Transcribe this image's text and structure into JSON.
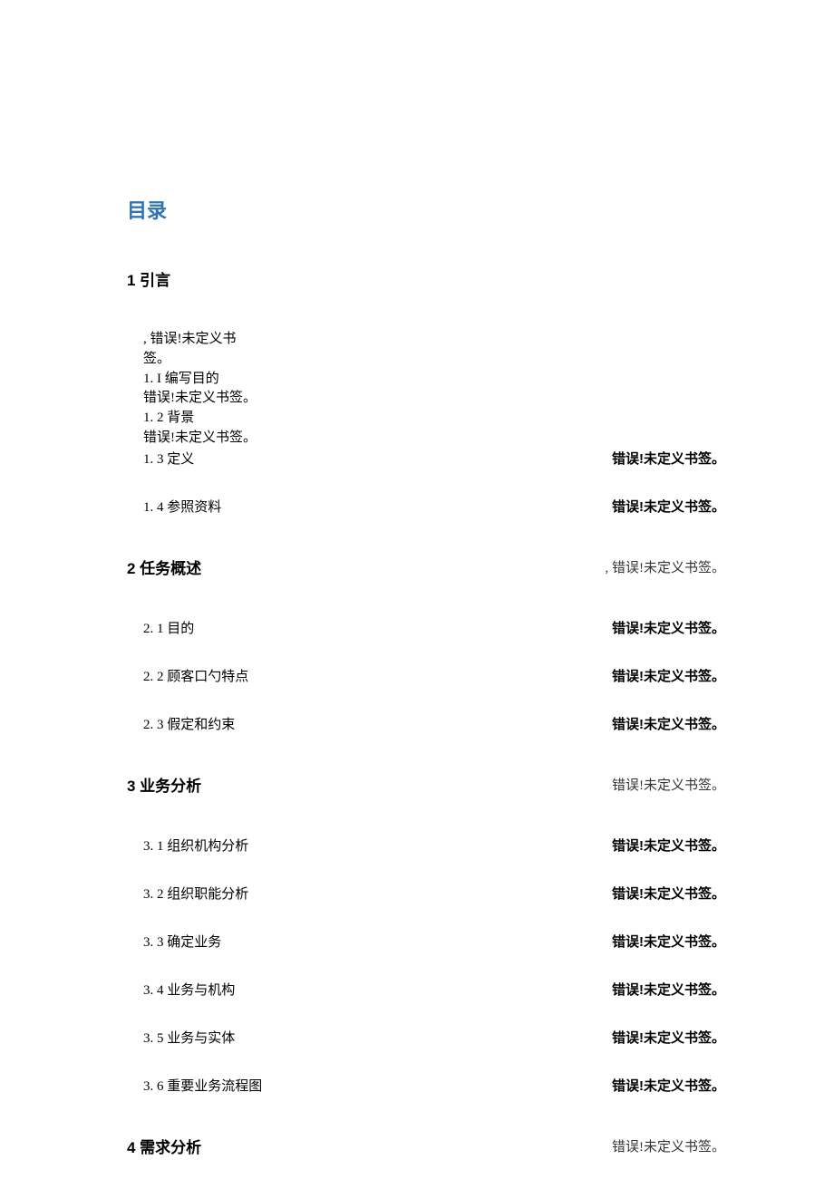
{
  "title": "目录",
  "error_bold": "错误!未定义书签。",
  "error_comma": ", 错误!未定义书签。",
  "error_plain": "错误!未定义书签。",
  "sec1": {
    "heading": "1 引言",
    "e0": ", 错误!未定义书签。",
    "e1a": "1. I 编写目的",
    "e1b": "错误!未定义书签。",
    "e2a": "1. 2 背景",
    "e2b": "错误!未定义书签。",
    "e3": "1. 3 定义",
    "e4": "1. 4 参照资料"
  },
  "sec2": {
    "heading": "2 任务概述",
    "i1": "2. 1 目的",
    "i2": "2. 2 顾客口勺特点",
    "i3": "2. 3 假定和约束"
  },
  "sec3": {
    "heading": "3 业务分析",
    "i1": "3. 1 组织机构分析",
    "i2": "3. 2 组织职能分析",
    "i3": "3. 3 确定业务",
    "i4": "3. 4 业务与机构",
    "i5": "3. 5 业务与实体",
    "i6": "3. 6 重要业务流程图"
  },
  "sec4": {
    "heading": "4 需求分析"
  }
}
